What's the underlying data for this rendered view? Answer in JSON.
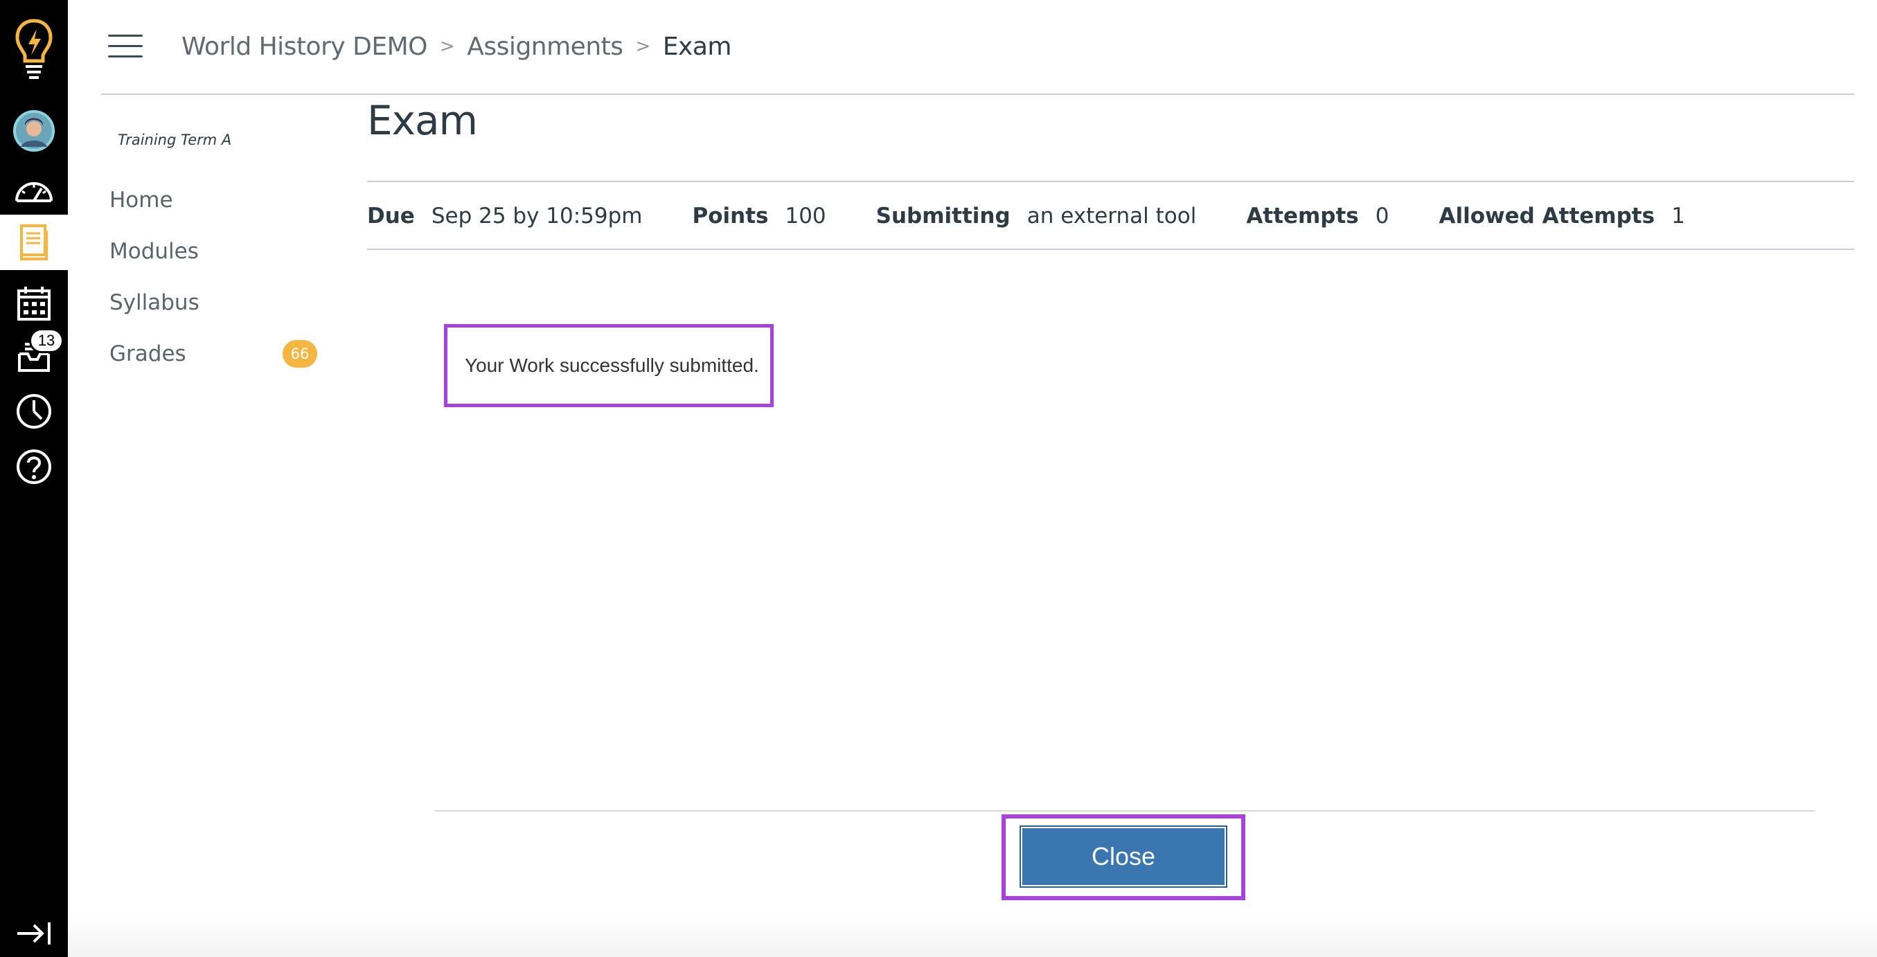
{
  "global_nav": {
    "items": [
      {
        "icon": "logo-lightbulb-icon"
      },
      {
        "icon": "account-avatar"
      },
      {
        "icon": "dashboard-gauge-icon"
      },
      {
        "icon": "courses-book-icon",
        "active": true
      },
      {
        "icon": "calendar-icon"
      },
      {
        "icon": "inbox-icon",
        "badge": "13"
      },
      {
        "icon": "history-clock-icon"
      },
      {
        "icon": "help-icon"
      }
    ],
    "collapse_icon": "collapse-nav-icon",
    "accent_color": "#f4b640"
  },
  "breadcrumb": {
    "course": "World History DEMO",
    "section": "Assignments",
    "current": "Exam",
    "separator": ">"
  },
  "course_nav": {
    "term": "Training Term A",
    "items": [
      {
        "label": "Home"
      },
      {
        "label": "Modules"
      },
      {
        "label": "Syllabus"
      },
      {
        "label": "Grades",
        "badge": "66"
      }
    ]
  },
  "assignment": {
    "title": "Exam",
    "details": [
      {
        "label": "Due",
        "value": "Sep 25 by 10:59pm"
      },
      {
        "label": "Points",
        "value": "100"
      },
      {
        "label": "Submitting",
        "value": "an external tool"
      },
      {
        "label": "Attempts",
        "value": "0"
      },
      {
        "label": "Allowed Attempts",
        "value": "1"
      }
    ]
  },
  "tool": {
    "message": "Your Work successfully submitted.",
    "close_label": "Close",
    "highlight_color": "#a742db",
    "button_color": "#3a76b0"
  }
}
